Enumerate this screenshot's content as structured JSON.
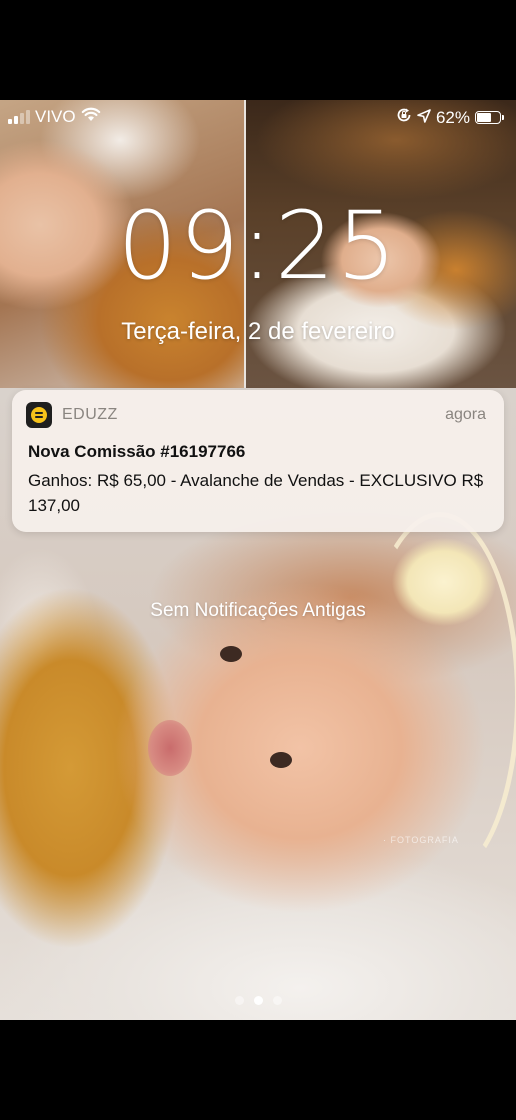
{
  "status_bar": {
    "carrier": "VIVO",
    "battery_percent": "62%",
    "battery_level": 0.62,
    "icons": [
      "signal-icon",
      "wifi-icon",
      "orientation-lock-icon",
      "location-arrow-icon",
      "battery-icon"
    ]
  },
  "lock_screen": {
    "time": "09:25",
    "date": "Terça-feira, 2 de fevereiro"
  },
  "notification": {
    "app_name": "EDUZZ",
    "app_icon": "eduzz-app-icon",
    "time": "agora",
    "title": "Nova Comissão #16197766",
    "body": "Ganhos: R$ 65,00 - Avalanche de Vendas - EXCLUSIVO R$ 137,00"
  },
  "no_older_notifications": "Sem Notificações Antigas",
  "page_indicator": {
    "count": 3,
    "active_index": 1
  },
  "colors": {
    "app_icon_accent": "#f6c21a",
    "notification_bg": "#f6f0ec"
  }
}
